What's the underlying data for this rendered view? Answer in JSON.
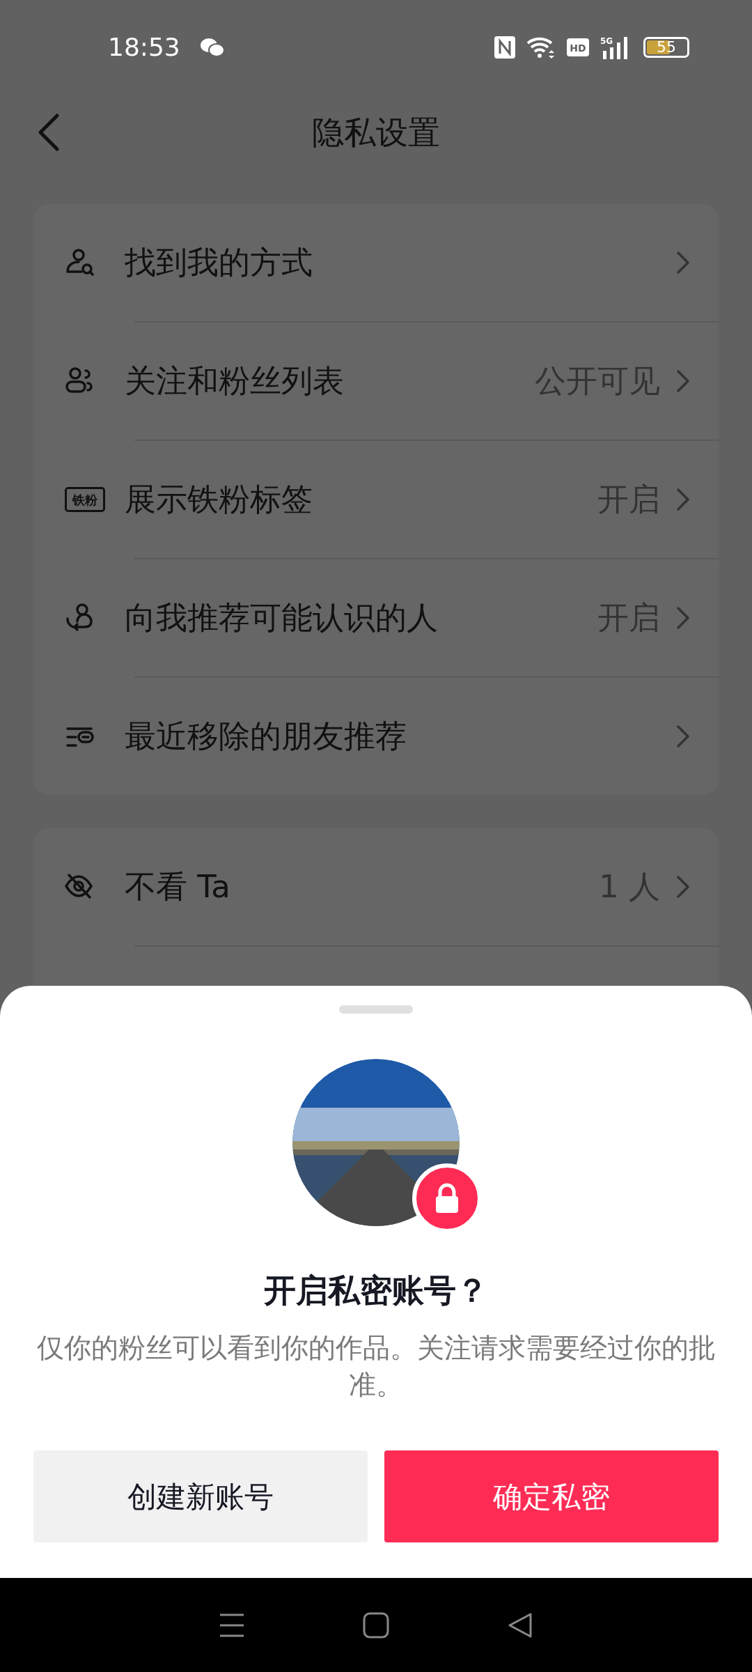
{
  "status_bar": {
    "time": "18:53",
    "hd_label": "HD",
    "network": "5G",
    "battery": "55"
  },
  "header": {
    "title": "隐私设置"
  },
  "groups": [
    {
      "items": [
        {
          "kind": "find",
          "label": "找到我的方式"
        },
        {
          "kind": "followers",
          "label": "关注和粉丝列表",
          "value": "公开可见"
        },
        {
          "kind": "badge",
          "label": "展示铁粉标签",
          "value": "开启",
          "badge_text": "铁粉"
        },
        {
          "kind": "recommend",
          "label": "向我推荐可能认识的人",
          "value": "开启"
        },
        {
          "kind": "removed",
          "label": "最近移除的朋友推荐"
        }
      ]
    },
    {
      "items": [
        {
          "kind": "hide",
          "label": "不看 Ta",
          "value": "1 人"
        }
      ]
    }
  ],
  "sheet": {
    "title": "开启私密账号？",
    "description": "仅你的粉丝可以看到你的作品。关注请求需要经过你的批准。",
    "buttons": [
      {
        "kind": "secondary",
        "label": "创建新账号"
      },
      {
        "kind": "primary",
        "label": "确定私密"
      }
    ]
  }
}
